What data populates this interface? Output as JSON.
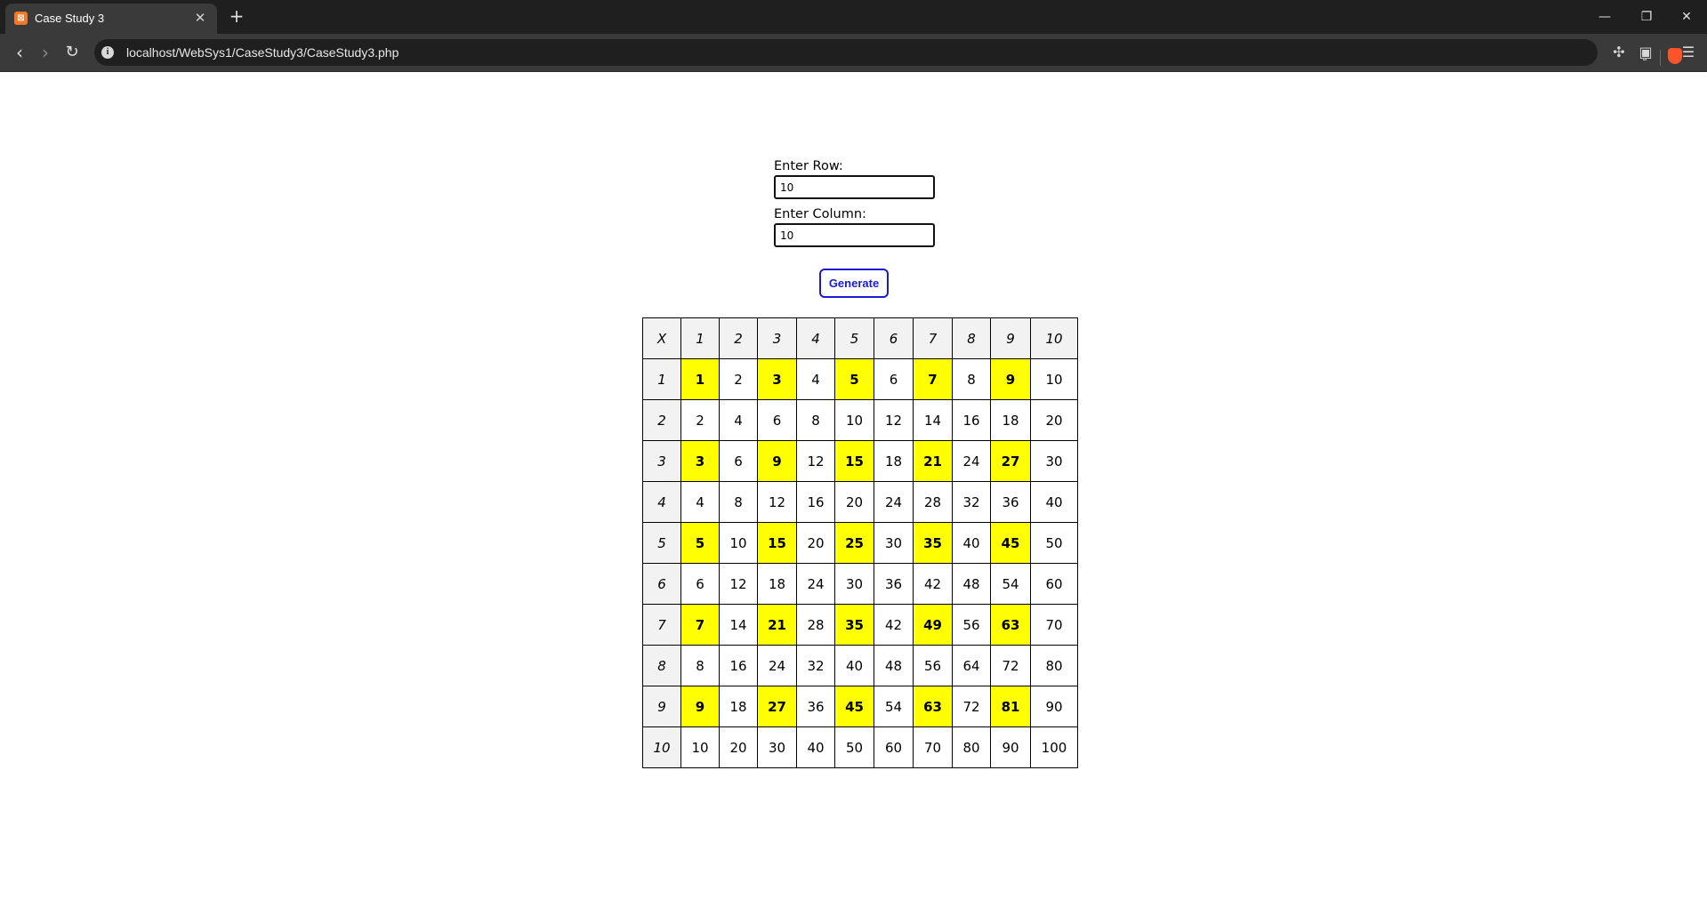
{
  "browser": {
    "tab_title": "Case Study 3",
    "tab_close": "✕",
    "new_tab": "+",
    "url": "localhost/WebSys1/CaseStudy3/CaseStudy3.php",
    "window_controls": [
      "—",
      "❐",
      "✕"
    ]
  },
  "form": {
    "row_label": "Enter Row:",
    "row_value": "10",
    "column_label": "Enter Column:",
    "column_value": "10",
    "generate_label": "Generate"
  },
  "table": {
    "corner": "X",
    "rows": 10,
    "columns": 10,
    "highlight_color": "#ffff00",
    "highlight_rule": "odd row and odd column"
  }
}
